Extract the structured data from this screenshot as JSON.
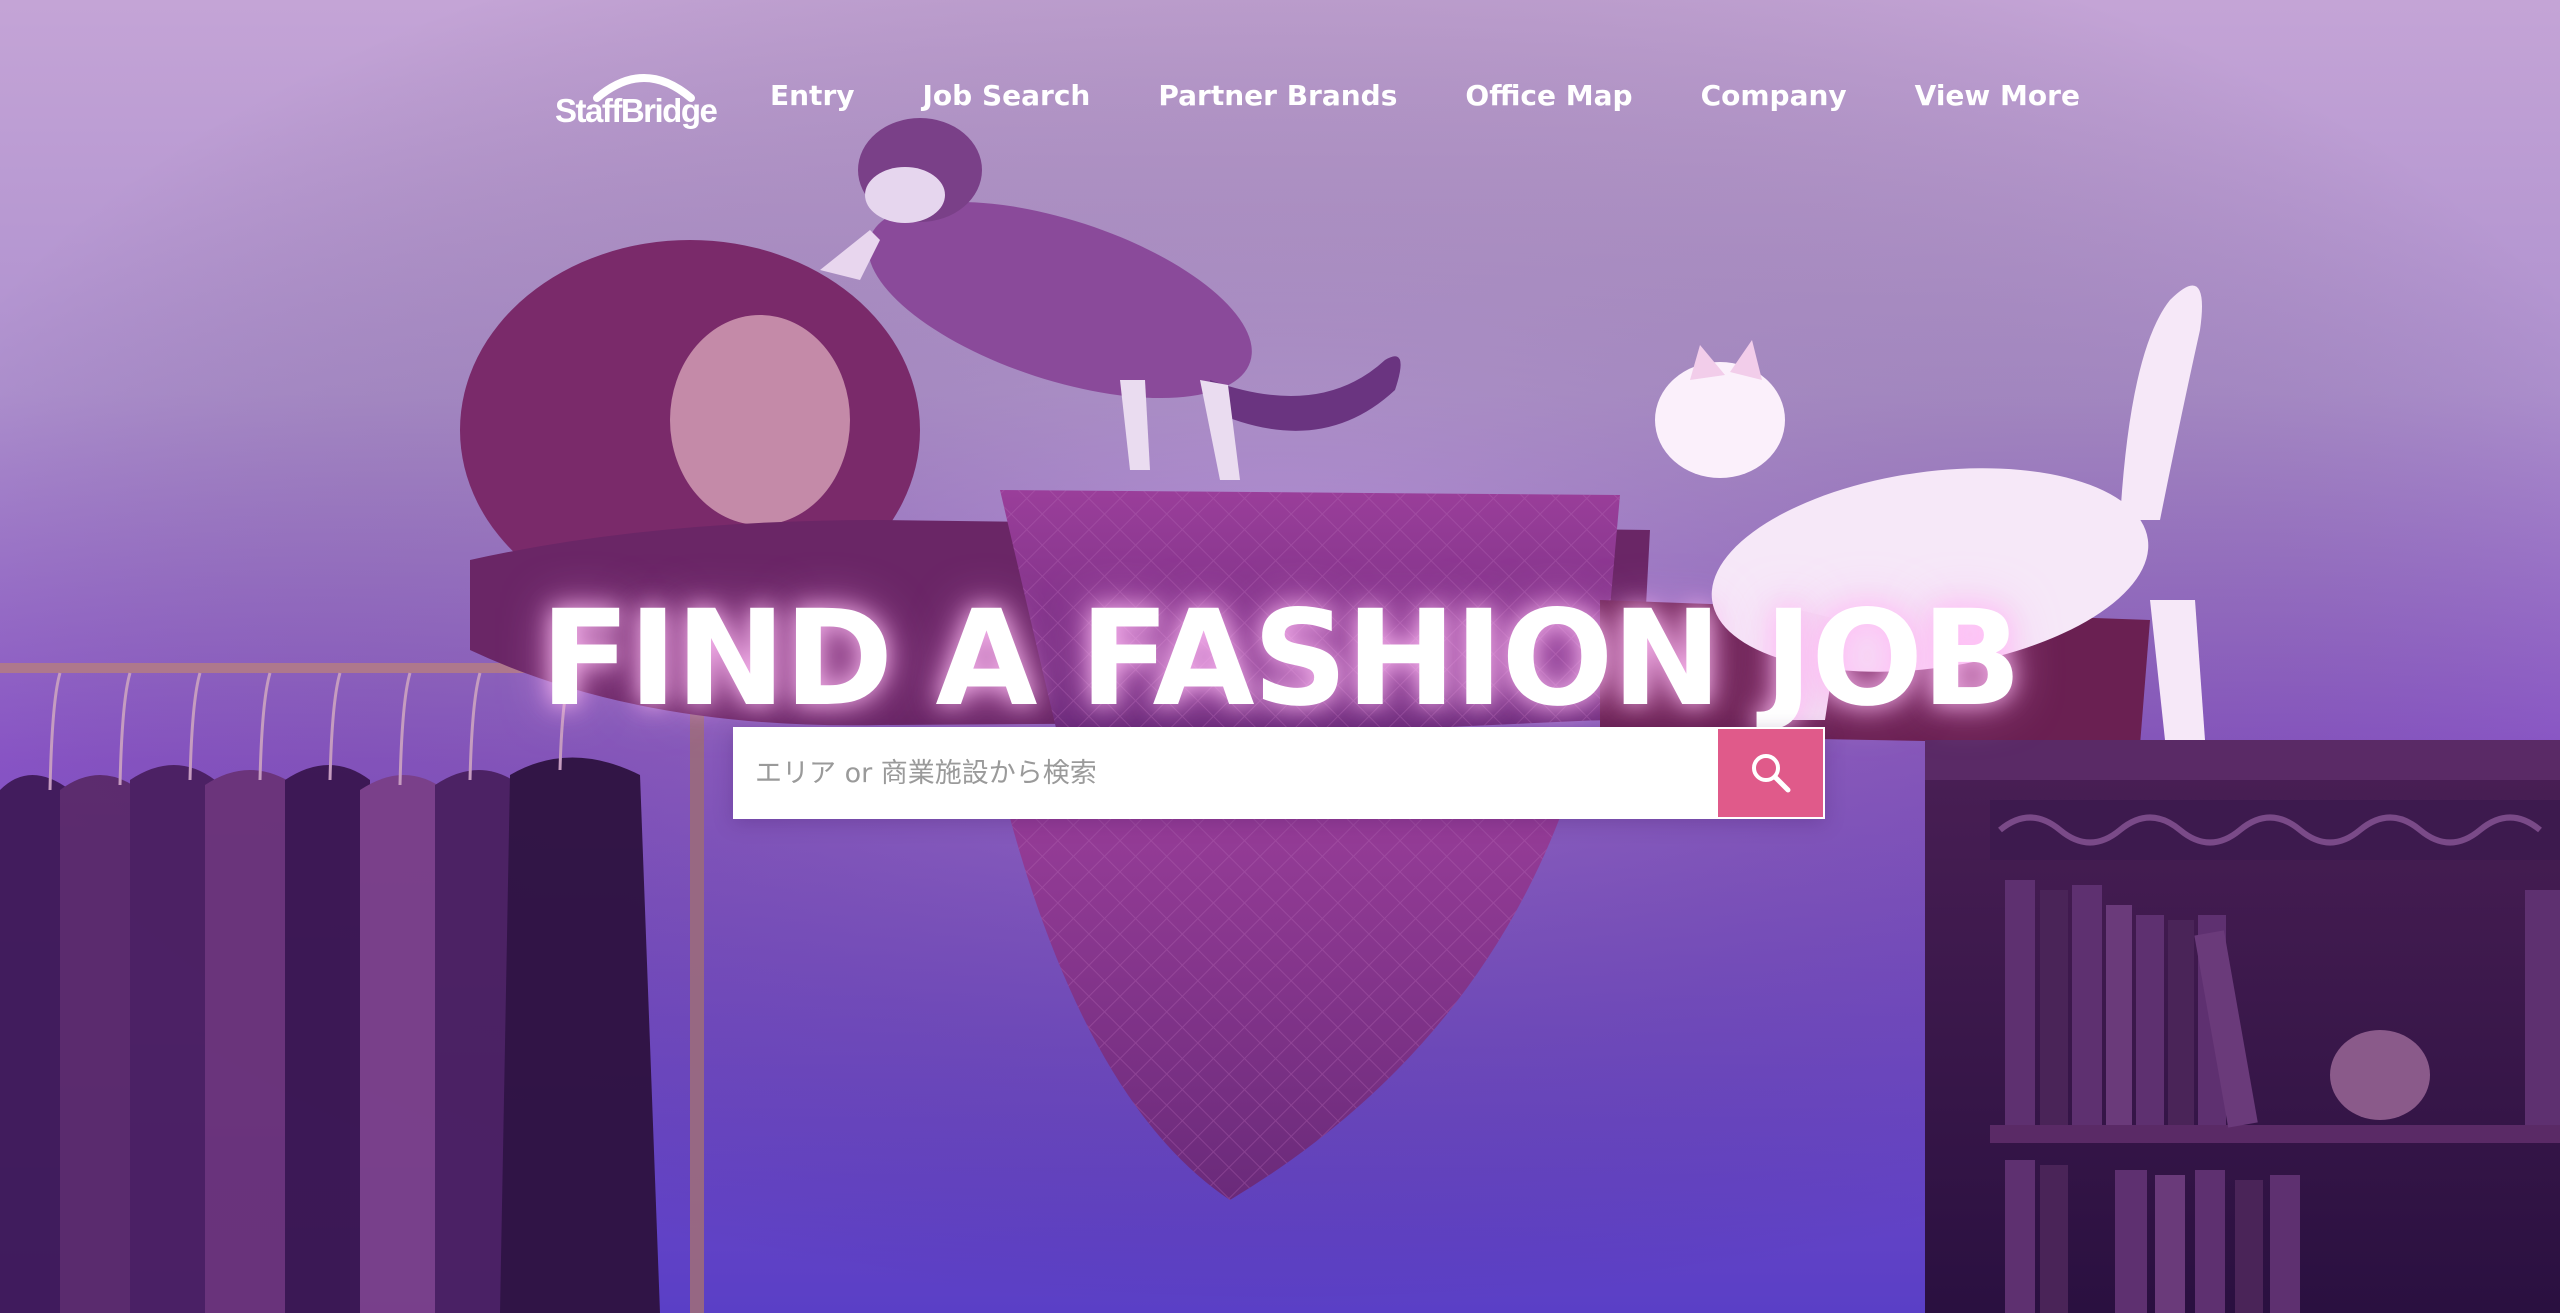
{
  "brand": {
    "name": "StaffBridge",
    "logo_icon": "arch-bridge-icon"
  },
  "nav": {
    "items": [
      {
        "label": "Entry"
      },
      {
        "label": "Job Search"
      },
      {
        "label": "Partner Brands"
      },
      {
        "label": "Office Map"
      },
      {
        "label": "Company"
      },
      {
        "label": "View More"
      }
    ]
  },
  "hero": {
    "title": "FIND A FASHION JOB"
  },
  "search": {
    "placeholder": "エリア or 商業施設から検索",
    "button_icon": "search-icon"
  },
  "colors": {
    "accent": "#e05a8a",
    "text": "#ffffff",
    "background_top": "#c4a4d6",
    "background_bottom": "#5a3fc6"
  }
}
